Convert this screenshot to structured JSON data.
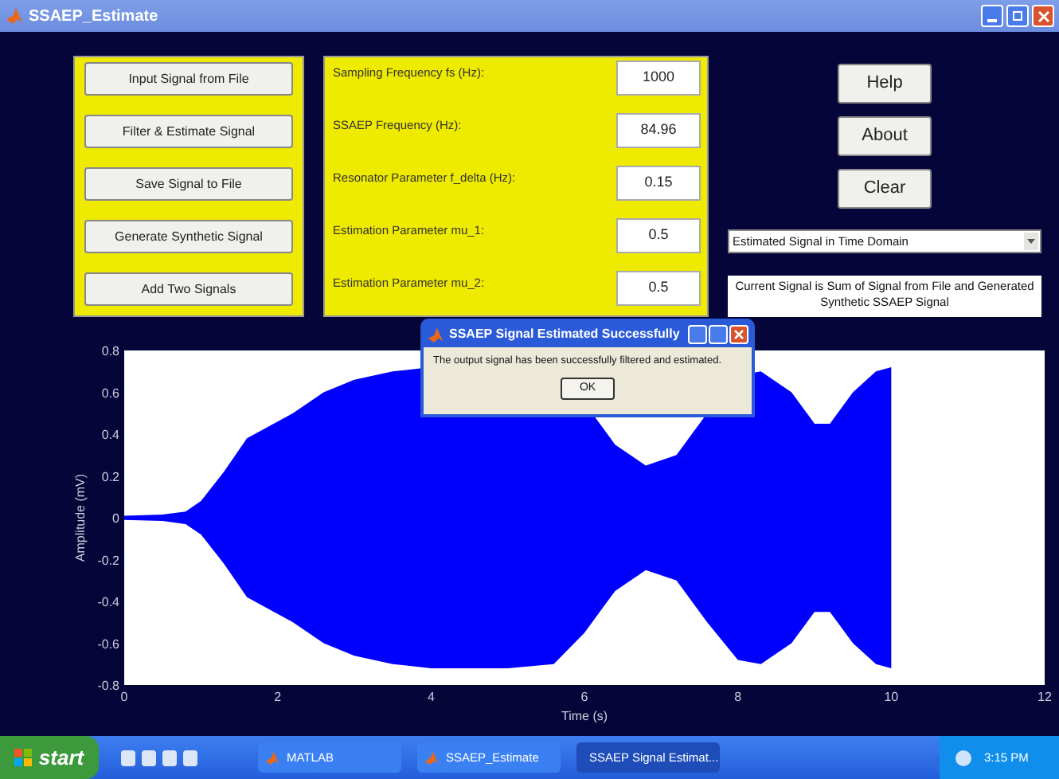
{
  "window": {
    "title": "SSAEP_Estimate"
  },
  "actions": [
    "Input Signal from File",
    "Filter & Estimate Signal",
    "Save Signal to File",
    "Generate Synthetic Signal",
    "Add Two Signals"
  ],
  "parameters": [
    {
      "label": "Sampling Frequency fs (Hz):",
      "value": "1000"
    },
    {
      "label": "SSAEP Frequency (Hz):",
      "value": "84.96"
    },
    {
      "label": "Resonator Parameter f_delta (Hz):",
      "value": "0.15"
    },
    {
      "label": "Estimation Parameter mu_1:",
      "value": "0.5"
    },
    {
      "label": "Estimation Parameter mu_2:",
      "value": "0.5"
    }
  ],
  "side_buttons": [
    "Help",
    "About",
    "Clear"
  ],
  "view_select": {
    "value": "Estimated Signal in Time Domain"
  },
  "status_text": "Current Signal is Sum of Signal from File and Generated Synthetic SSAEP Signal",
  "plot": {
    "ylabel": "Amplitude (mV)",
    "xlabel": "Time (s)",
    "yticks": [
      "0.8",
      "0.6",
      "0.4",
      "0.2",
      "0",
      "-0.2",
      "-0.4",
      "-0.6",
      "-0.8"
    ],
    "xticks": [
      "0",
      "2",
      "4",
      "6",
      "8",
      "10",
      "12"
    ]
  },
  "dialog": {
    "title": "SSAEP Signal Estimated Successfully",
    "message": "The output signal has been successfully filtered and estimated.",
    "button": "OK"
  },
  "taskbar": {
    "start": "start",
    "tasks": [
      {
        "label": "MATLAB",
        "selected": false
      },
      {
        "label": "SSAEP_Estimate",
        "selected": false
      },
      {
        "label": "SSAEP Signal Estimat...",
        "selected": true
      }
    ],
    "clock": "3:15 PM"
  }
}
